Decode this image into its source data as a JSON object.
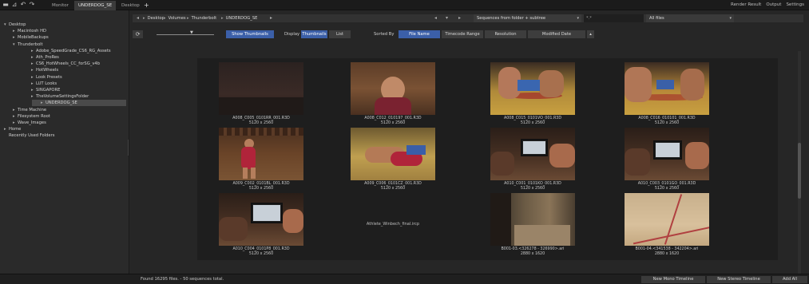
{
  "tabs": {
    "monitor": "Monitor",
    "underdog": "UNDERDOG_SE",
    "desktop": "Desktop",
    "add": "+"
  },
  "top_right": [
    "Render Result",
    "Output",
    "Settings"
  ],
  "tree": [
    {
      "label": "Desktop",
      "expanded": true,
      "indent": 0
    },
    {
      "label": "Macintosh HD",
      "expanded": false,
      "indent": 1
    },
    {
      "label": "MobileBackups",
      "expanded": false,
      "indent": 1
    },
    {
      "label": "Thunderbolt",
      "expanded": true,
      "indent": 1
    },
    {
      "label": "Adobe_SpeedGrade_CS6_RG_Assets",
      "expanded": false,
      "indent": 2
    },
    {
      "label": "Ath_ProRes",
      "expanded": false,
      "indent": 2
    },
    {
      "label": "CS6_HotWheels_CC_forSG_v4b",
      "expanded": false,
      "indent": 2
    },
    {
      "label": "HotWheels",
      "expanded": false,
      "indent": 2
    },
    {
      "label": "Look Presets",
      "expanded": false,
      "indent": 2
    },
    {
      "label": "LUT Looks",
      "expanded": false,
      "indent": 2
    },
    {
      "label": "SINGAPORE",
      "expanded": false,
      "indent": 2
    },
    {
      "label": "TheVolumeSettingsFolder",
      "expanded": false,
      "indent": 2
    },
    {
      "label": "UNDERDOG_SE",
      "expanded": false,
      "indent": 2,
      "selected": true
    },
    {
      "label": "Time Machine",
      "expanded": false,
      "indent": 1
    },
    {
      "label": "Filesystem Root",
      "expanded": false,
      "indent": 1
    },
    {
      "label": "Wave_Images",
      "expanded": false,
      "indent": 1
    },
    {
      "label": "Home",
      "expanded": false,
      "indent": 0
    },
    {
      "label": "Recently Used Folders",
      "expanded": null,
      "indent": 0
    }
  ],
  "path": {
    "crumbs": [
      "Desktop",
      "Volumes",
      "Thunderbolt",
      "UNDERDOG_SE"
    ],
    "source_filter": "Sequences from folder + subtree",
    "search": "*.*",
    "file_filter": "All files"
  },
  "toolbar": {
    "refresh": "⟳",
    "show_thumbnails": "Show Thumbnails",
    "display_label": "Display",
    "thumbnails": "Thumbnails",
    "list": "List",
    "sorted_by_label": "Sorted By",
    "sort_options": [
      "File Name",
      "Timecode Range",
      "Resolution",
      "Modified Date"
    ],
    "sort_dir": "▴"
  },
  "items": [
    {
      "name": "A008_C005_0101RR_001.R3D",
      "res": "5120 x 2560",
      "scene": "dark"
    },
    {
      "name": "A008_C012_010197_001.R3D",
      "res": "5120 x 2560",
      "scene": "portrait"
    },
    {
      "name": "A008_C015_0101VO_001.R3D",
      "res": "5120 x 2560",
      "scene": "wrestle-mat"
    },
    {
      "name": "A008_C016_010101_001.R3D",
      "res": "5120 x 2560",
      "scene": "wrestle-mat2"
    },
    {
      "name": "A009_C002_0101BL_001.R3D",
      "res": "5120 x 2560",
      "scene": "gym-red"
    },
    {
      "name": "A009_C006_0101CZ_001.R3D",
      "res": "5120 x 2560",
      "scene": "ground"
    },
    {
      "name": "A010_C001_0101KO_001.R3D",
      "res": "5120 x 2560",
      "scene": "tablet"
    },
    {
      "name": "A010_C003_0101GO_001.R3D",
      "res": "5120 x 2560",
      "scene": "tablet2"
    },
    {
      "name": "A010_C004_0101P8_001.R3D",
      "res": "5120 x 2560",
      "scene": "tablet3"
    },
    {
      "name": "Athlete_Winbech_final.ircp",
      "res": "",
      "scene": "none"
    },
    {
      "name": "B001-03.<326278 - 326990>.ari",
      "res": "2880 x 1620",
      "scene": "hall"
    },
    {
      "name": "B001-04.<341538 - 342204>.ari",
      "res": "2880 x 1620",
      "scene": "floor"
    }
  ],
  "status": {
    "found": "Found 16295 files. - 50 sequences total.",
    "new_mono": "New Mono Timeline",
    "new_stereo": "New Stereo Timeline",
    "add_all": "Add All"
  },
  "colors": {
    "accent": "#3b5fa8",
    "background": "#262626",
    "panel": "#2a2a2a",
    "grid_bg": "#1e1e1e"
  }
}
